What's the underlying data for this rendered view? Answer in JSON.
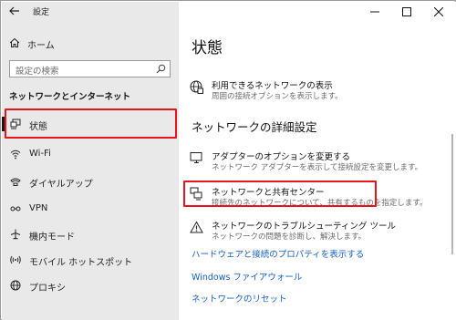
{
  "window": {
    "title": "設定"
  },
  "sidebar": {
    "home_label": "ホーム",
    "search_placeholder": "設定の検索",
    "section_title": "ネットワークとインターネット",
    "items": [
      {
        "label": "状態",
        "icon": "status-icon",
        "selected": true
      },
      {
        "label": "Wi-Fi",
        "icon": "wifi-icon"
      },
      {
        "label": "ダイヤルアップ",
        "icon": "dialup-icon"
      },
      {
        "label": "VPN",
        "icon": "vpn-icon"
      },
      {
        "label": "機内モード",
        "icon": "airplane-icon"
      },
      {
        "label": "モバイル ホットスポット",
        "icon": "hotspot-icon"
      },
      {
        "label": "プロキシ",
        "icon": "globe-icon"
      }
    ]
  },
  "main": {
    "title": "状態",
    "available_networks": {
      "title": "利用できるネットワークの表示",
      "desc": "周囲の接続オプションを表示します。"
    },
    "advanced_heading": "ネットワークの詳細設定",
    "entries": [
      {
        "title": "アダプターのオプションを変更する",
        "desc": "ネットワーク アダプターを表示して接続設定を変更します。",
        "icon": "adapter-icon"
      },
      {
        "title": "ネットワークと共有センター",
        "desc": "接続先のネットワークについて、共有するものを指定します。",
        "icon": "sharing-center-icon"
      },
      {
        "title": "ネットワークのトラブルシューティング ツール",
        "desc": "ネットワークの問題を診断し、解決します。",
        "icon": "warning-icon"
      }
    ],
    "links": {
      "hardware": "ハードウェアと接続のプロパティを表示する",
      "firewall": "Windows ファイアウォール",
      "reset": "ネットワークのリセット"
    }
  },
  "colors": {
    "highlight": "#e8141a",
    "link": "#1560c8",
    "sidebar_bg": "#e9e9e9"
  }
}
